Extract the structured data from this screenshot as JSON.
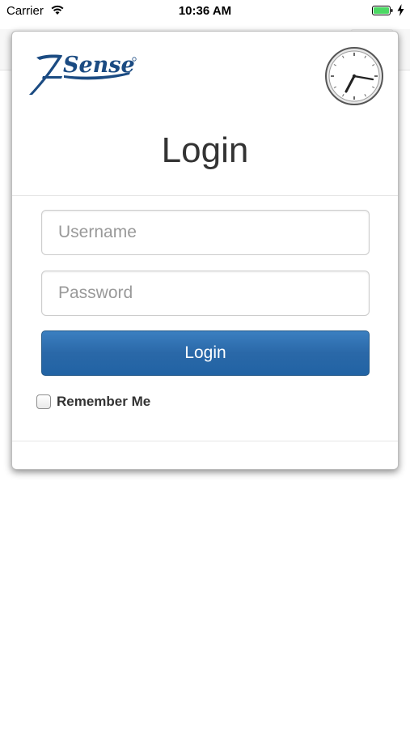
{
  "status_bar": {
    "carrier": "Carrier",
    "time": "10:36 AM",
    "wifi_icon": "wifi-icon",
    "battery_icon": "battery-icon",
    "charging_icon": "charging-bolt-icon",
    "battery_color": "#4cd964"
  },
  "modal": {
    "logo_text": "7Sense",
    "logo_color": "#1b4b82",
    "clock_icon": "clock-icon",
    "title": "Login",
    "username": {
      "placeholder": "Username",
      "value": ""
    },
    "password": {
      "placeholder": "Password",
      "value": ""
    },
    "login_button": {
      "label": "Login",
      "color": "#2a68a8"
    },
    "remember_me": {
      "label": "Remember Me",
      "checked": false
    }
  }
}
